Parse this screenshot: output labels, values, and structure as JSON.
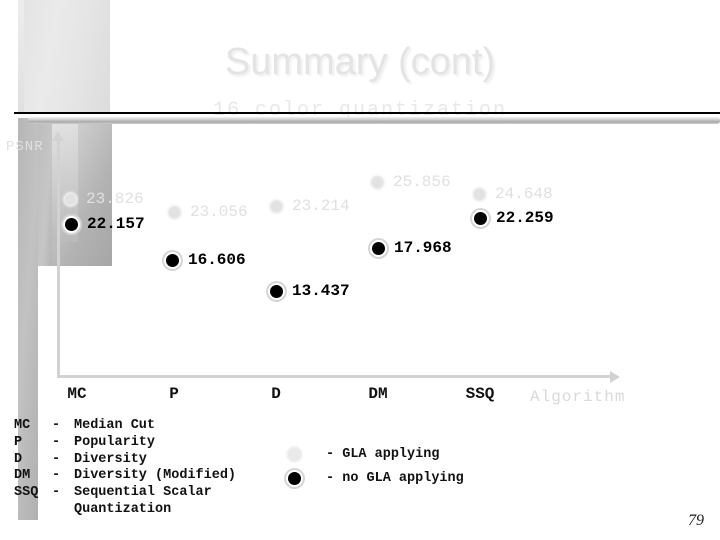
{
  "slide": {
    "title": "Summary (cont)",
    "subtitle": "16 color quantization",
    "page_number": "79",
    "title_color": "#e4e4e4",
    "subtitle_color": "#e8e8e8"
  },
  "chart_data": {
    "type": "scatter",
    "title": "16 color quantization",
    "xlabel": "Algorithm",
    "ylabel": "PSNR",
    "categories": [
      "MC",
      "P",
      "D",
      "DM",
      "SSQ"
    ],
    "grid": false,
    "legend_position": "bottom-center",
    "series": [
      {
        "name": "GLA applying",
        "color": "#e2e2e2",
        "marker": "circle-light",
        "values": [
          23.826,
          23.056,
          23.214,
          25.856,
          24.648
        ],
        "labels": [
          "23.826",
          "23.056",
          "23.214",
          "25.856",
          "24.648"
        ]
      },
      {
        "name": "no GLA applying",
        "color": "#000000",
        "marker": "circle-dark",
        "values": [
          22.157,
          16.606,
          13.437,
          17.968,
          22.259
        ],
        "labels": [
          "22.157",
          "16.606",
          "13.437",
          "17.968",
          "22.259"
        ]
      }
    ],
    "axis_labels": {
      "y": "PSNR",
      "x": "Algorithm"
    }
  },
  "abbreviations": [
    {
      "key": "MC",
      "dash": "-",
      "text": "Median Cut"
    },
    {
      "key": "P",
      "dash": "-",
      "text": "Popularity"
    },
    {
      "key": "D",
      "dash": "-",
      "text": "Diversity"
    },
    {
      "key": "DM",
      "dash": "-",
      "text": "Diversity (Modified)"
    },
    {
      "key": "SSQ",
      "dash": "-",
      "text": "Sequential Scalar"
    }
  ],
  "abbreviation_continuation": "Quantization",
  "series_legend": [
    {
      "dash": "-",
      "label": "GLA applying"
    },
    {
      "dash": "-",
      "label": "no GLA applying"
    }
  ]
}
